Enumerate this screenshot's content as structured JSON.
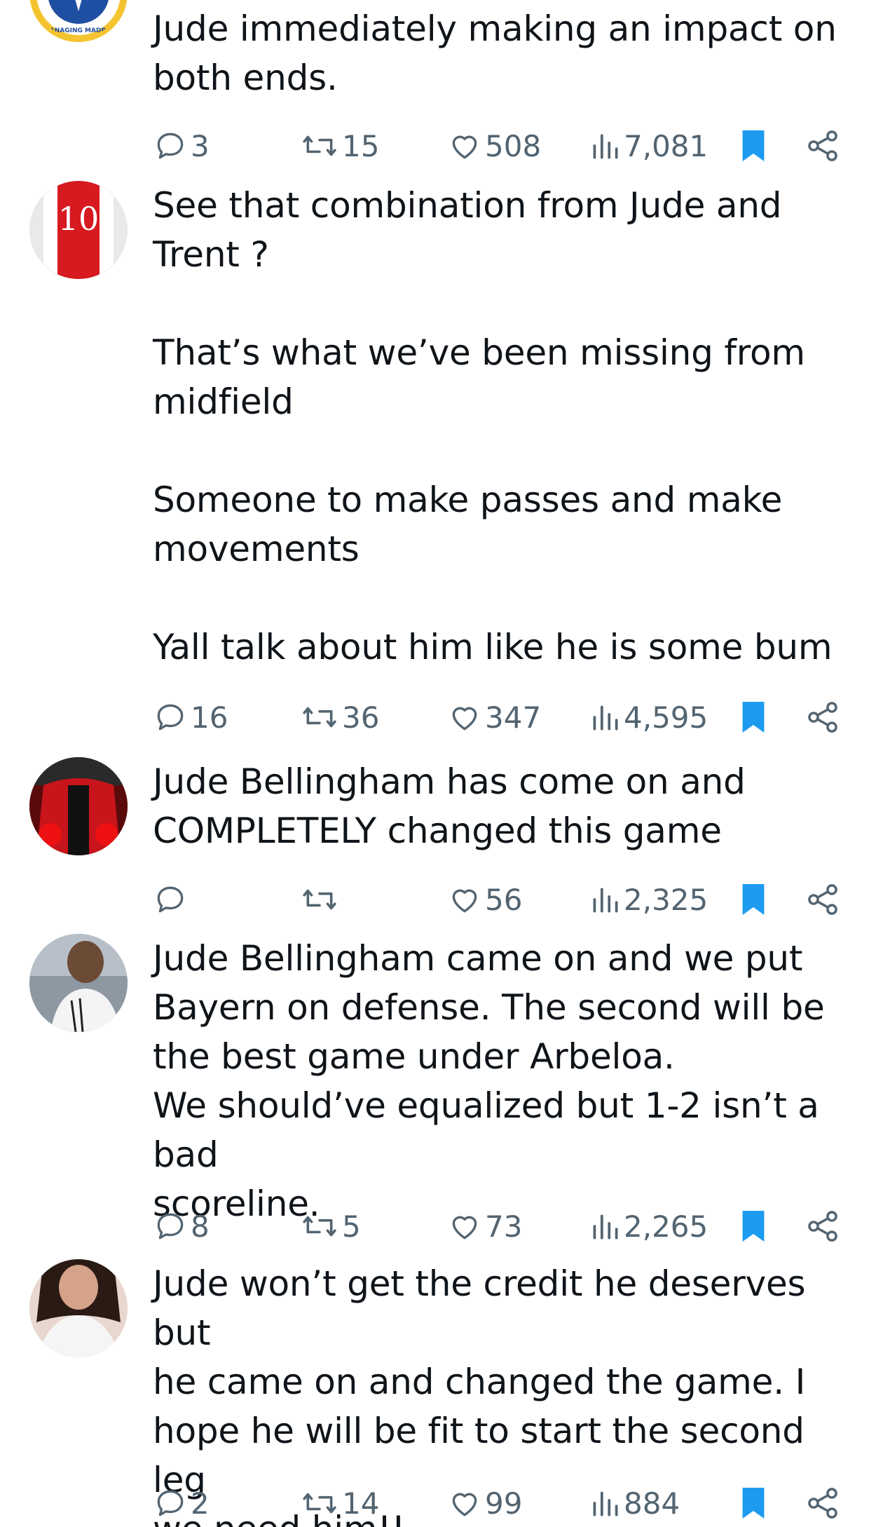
{
  "posts": [
    {
      "id": "p1",
      "avatar_desc": "managing-madrid-logo",
      "text": "Jude immediately making an impact on\nboth ends.",
      "replies": "3",
      "reposts": "15",
      "likes": "508",
      "views": "7,081",
      "avatar_text": "MANAGING MADRID"
    },
    {
      "id": "p2",
      "avatar_desc": "arsenal-10-jersey",
      "text": "See that combination from Jude and\nTrent ?\n\nThat’s what we’ve been missing from\nmidfield\n\nSomeone to make passes and make\nmovements\n\nYall talk about him like he is some bum",
      "replies": "16",
      "reposts": "36",
      "likes": "347",
      "views": "4,595",
      "avatar_text": "10"
    },
    {
      "id": "p3",
      "avatar_desc": "person-red-jacket",
      "text": "Jude Bellingham has come on and\nCOMPLETELY changed this game",
      "replies": "",
      "reposts": "",
      "likes": "56",
      "views": "2,325"
    },
    {
      "id": "p4",
      "avatar_desc": "footballer-photo",
      "text": "Jude Bellingham came on and we put\nBayern on defense. The second will be\nthe best game under Arbeloa.\nWe should’ve equalized but 1-2 isn’t a bad\nscoreline.",
      "replies": "8",
      "reposts": "5",
      "likes": "73",
      "views": "2,265"
    },
    {
      "id": "p5",
      "avatar_desc": "woman-photo",
      "text": "Jude won’t get the credit he deserves but\nhe came on and changed the game. I\nhope he will be fit to start the second leg\nwe need him!!",
      "replies": "2",
      "reposts": "14",
      "likes": "99",
      "views": "884"
    }
  ],
  "colors": {
    "text": "#0f1419",
    "muted": "#536471",
    "bookmark": "#1d9bf0"
  }
}
